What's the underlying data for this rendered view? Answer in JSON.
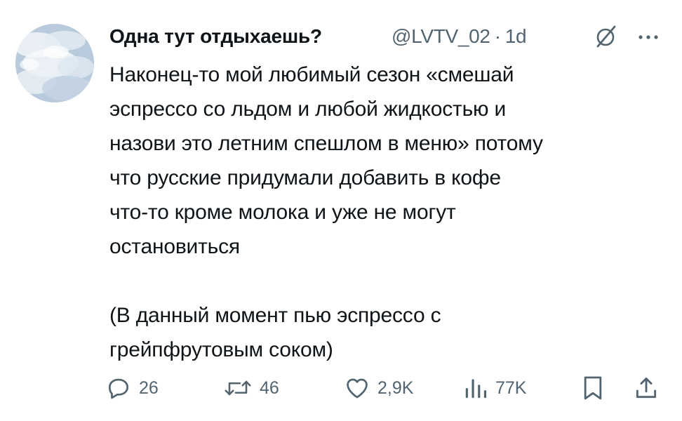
{
  "tweet": {
    "author": {
      "display_name": "Одна тут отдыхаешь?",
      "handle": "@LVTV_02",
      "separator": "·",
      "time": "1d"
    },
    "text": "Наконец-то мой любимый сезон «смешай\nэспрессо со льдом и любой жидкостью и\nназови это летним спешлом в меню» потому\nчто русские придумали добавить в кофе\nчто-то кроме молока и уже не могут\nостановиться\n\n(В данный момент пью эспрессо с\nгрейпфрутовым соком)",
    "actions": {
      "replies": "26",
      "reposts": "46",
      "likes": "2,9K",
      "views": "77K"
    }
  },
  "icons": {
    "avatar": "cloud-sky-avatar",
    "grok": "grok-icon",
    "more": "more-options-icon",
    "reply": "reply-icon",
    "repost": "repost-icon",
    "like": "heart-icon",
    "views": "views-chart-icon",
    "bookmark": "bookmark-icon",
    "share": "share-icon"
  },
  "colors": {
    "text": "#0f1419",
    "secondary": "#536471",
    "background": "#ffffff"
  }
}
